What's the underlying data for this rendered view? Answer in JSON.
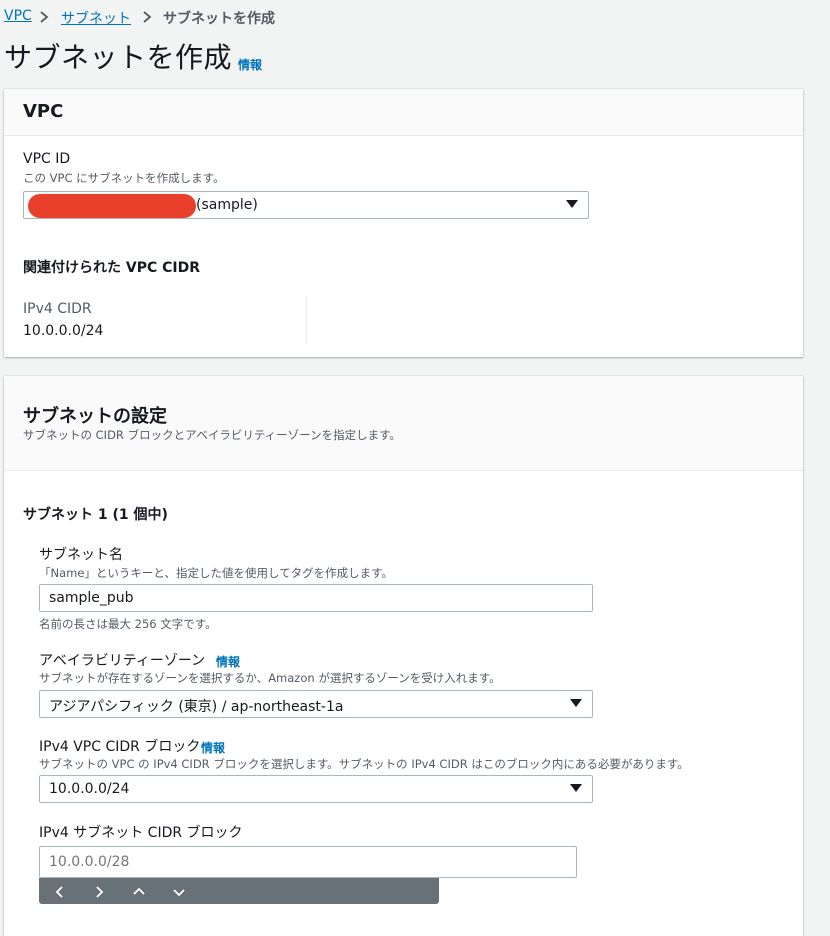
{
  "breadcrumb": {
    "items": [
      "VPC",
      "サブネット"
    ],
    "current": "サブネットを作成"
  },
  "page": {
    "title": "サブネットを作成",
    "info": "情報"
  },
  "vpc_section": {
    "title": "VPC",
    "vpc_id_label": "VPC ID",
    "vpc_id_desc": "この VPC にサブネットを作成します。",
    "vpc_id_value": "(sample)",
    "cidr_heading": "関連付けられた VPC CIDR",
    "ipv4_cidr_label": "IPv4 CIDR",
    "ipv4_cidr_value": "10.0.0.0/24"
  },
  "subnet_section": {
    "title": "サブネットの設定",
    "desc": "サブネットの CIDR ブロックとアベイラビリティーゾーンを指定します。",
    "subnet_heading": "サブネット 1 (1 個中)",
    "name_label": "サブネット名",
    "name_desc": "「Name」というキーと、指定した値を使用してタグを作成します。",
    "name_value": "sample_pub",
    "name_hint": "名前の長さは最大 256 文字です。",
    "az_label": "アベイラビリティーゾーン",
    "az_info": "情報",
    "az_desc": "サブネットが存在するゾーンを選択するか、Amazon が選択するゾーンを受け入れます。",
    "az_value": "アジアパシフィック (東京) / ap-northeast-1a",
    "vpc_cidr_label": "IPv4 VPC CIDR ブロック",
    "vpc_cidr_info": "情報",
    "vpc_cidr_desc": "サブネットの VPC の IPv4 CIDR ブロックを選択します。サブネットの IPv4 CIDR はこのブロック内にある必要があります。",
    "vpc_cidr_value": "10.0.0.0/24",
    "subnet_cidr_label": "IPv4 サブネット CIDR ブロック",
    "subnet_cidr_placeholder": "10.0.0.0/28"
  },
  "icons": {
    "breadcrumb_separator": "chevron-right-icon",
    "dropdown": "caret-down-icon",
    "autocomplete": [
      "chevron-left-icon",
      "chevron-right-icon",
      "chevron-up-icon",
      "chevron-down-icon"
    ]
  },
  "colors": {
    "link": "#0073bb",
    "background": "#f2f3f3",
    "redaction": "#e8402a",
    "autocomplete_bar": "#687078"
  }
}
